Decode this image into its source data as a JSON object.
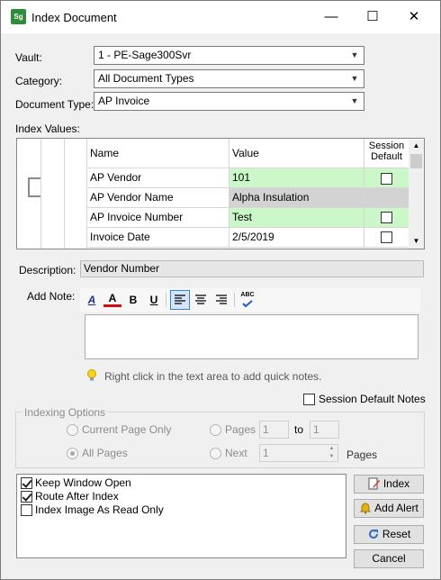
{
  "window": {
    "title": "Index Document",
    "app_icon": "Sg",
    "minimize": "—",
    "maximize": "☐",
    "close": "✕"
  },
  "fields": {
    "vault_label": "Vault:",
    "vault_value": "1 - PE-Sage300Svr",
    "category_label": "Category:",
    "category_value": "All Document Types",
    "doctype_label": "Document Type:",
    "doctype_value": "AP Invoice"
  },
  "index_values": {
    "label": "Index Values:",
    "headers": {
      "name": "Name",
      "value": "Value",
      "session_default": "Session Default"
    },
    "rows": [
      {
        "name": "AP Vendor",
        "value": "101",
        "checked": false,
        "state": "required"
      },
      {
        "name": "AP Vendor Name",
        "value": "Alpha Insulation",
        "checked": false,
        "state": "readonly"
      },
      {
        "name": "AP Invoice Number",
        "value": "Test",
        "checked": false,
        "state": "required"
      },
      {
        "name": "Invoice Date",
        "value": "2/5/2019",
        "checked": false,
        "state": "normal"
      }
    ]
  },
  "description": {
    "label": "Description:",
    "value": "Vendor Number"
  },
  "note": {
    "label": "Add Note:",
    "toolbar": {
      "font": "A",
      "color": "A",
      "bold": "B",
      "underline": "U",
      "spell": "ABC"
    },
    "hint": "Right click in the text area to add quick notes.",
    "session_default_notes": "Session Default Notes"
  },
  "indexing_options": {
    "title": "Indexing Options",
    "current_page_only": "Current Page Only",
    "all_pages": "All Pages",
    "pages": "Pages",
    "pages_from": "1",
    "to": "to",
    "pages_to": "1",
    "next": "Next",
    "next_value": "1",
    "pages_suffix": "Pages"
  },
  "options": [
    {
      "label": "Keep Window Open",
      "checked": true
    },
    {
      "label": "Route After Index",
      "checked": true
    },
    {
      "label": "Index Image As Read Only",
      "checked": false
    }
  ],
  "buttons": {
    "index": "Index",
    "add_alert": "Add Alert",
    "reset": "Reset",
    "cancel": "Cancel"
  },
  "colors": {
    "required": "#ccf7c8",
    "readonly": "#d3d3d3",
    "accent": "#2f8c3a"
  }
}
